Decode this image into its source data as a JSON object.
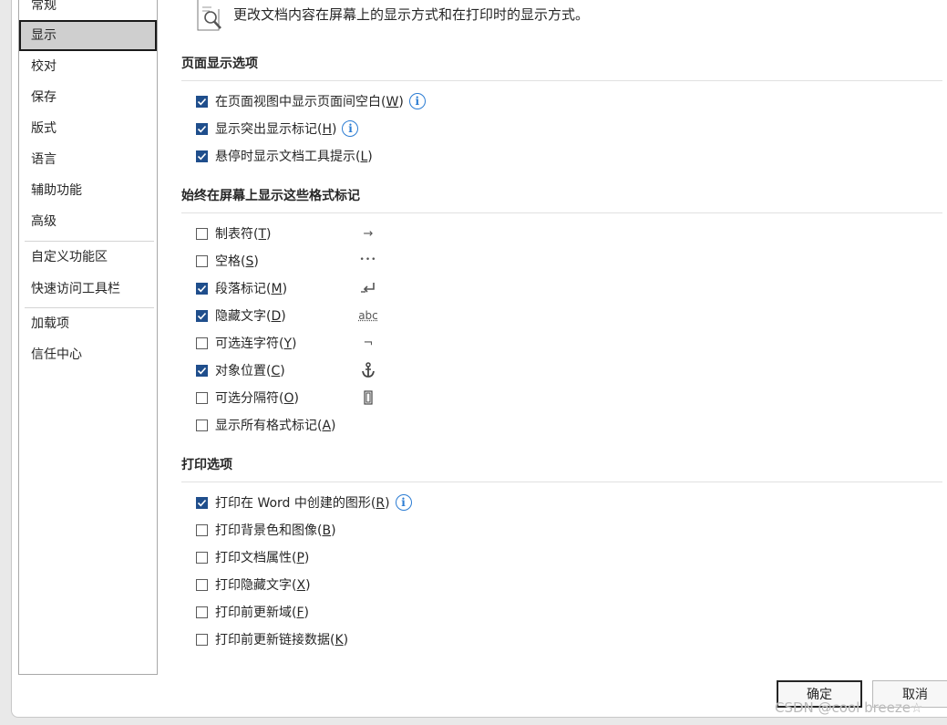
{
  "nav": {
    "items": [
      {
        "label": "常规"
      },
      {
        "label": "显示"
      },
      {
        "label": "校对"
      },
      {
        "label": "保存"
      },
      {
        "label": "版式"
      },
      {
        "label": "语言"
      },
      {
        "label": "辅助功能"
      },
      {
        "label": "高级"
      },
      {
        "label": "自定义功能区"
      },
      {
        "label": "快速访问工具栏"
      },
      {
        "label": "加载项"
      },
      {
        "label": "信任中心"
      }
    ],
    "selected": "显示"
  },
  "header": {
    "icon": "document-magnifier-icon",
    "text": "更改文档内容在屏幕上的显示方式和在打印时的显示方式。"
  },
  "sections": {
    "page_display": {
      "title": "页面显示选项",
      "options": [
        {
          "label": "在页面视图中显示页面间空白(",
          "key": "W",
          "checked": true,
          "info": true
        },
        {
          "label": "显示突出显示标记(",
          "key": "H",
          "checked": true,
          "info": true
        },
        {
          "label": "悬停时显示文档工具提示(",
          "key": "L",
          "checked": true,
          "info": false
        }
      ]
    },
    "format_marks": {
      "title": "始终在屏幕上显示这些格式标记",
      "options": [
        {
          "label": "制表符(",
          "key": "T",
          "checked": false,
          "mark": "→"
        },
        {
          "label": "空格(",
          "key": "S",
          "checked": false,
          "mark": "•••"
        },
        {
          "label": "段落标记(",
          "key": "M",
          "checked": true,
          "mark": "paragraph-mark-icon"
        },
        {
          "label": "隐藏文字(",
          "key": "D",
          "checked": true,
          "mark": "abc"
        },
        {
          "label": "可选连字符(",
          "key": "Y",
          "checked": false,
          "mark": "¬"
        },
        {
          "label": "对象位置(",
          "key": "C",
          "checked": true,
          "mark": "anchor-icon"
        },
        {
          "label": "可选分隔符(",
          "key": "O",
          "checked": false,
          "mark": "optional-break-icon"
        },
        {
          "label": "显示所有格式标记(",
          "key": "A",
          "checked": false,
          "mark": ""
        }
      ]
    },
    "print": {
      "title": "打印选项",
      "options": [
        {
          "label": "打印在 Word 中创建的图形(",
          "key": "R",
          "checked": true,
          "info": true
        },
        {
          "label": "打印背景色和图像(",
          "key": "B",
          "checked": false,
          "info": false
        },
        {
          "label": "打印文档属性(",
          "key": "P",
          "checked": false,
          "info": false
        },
        {
          "label": "打印隐藏文字(",
          "key": "X",
          "checked": false,
          "info": false
        },
        {
          "label": "打印前更新域(",
          "key": "F",
          "checked": false,
          "info": false
        },
        {
          "label": "打印前更新链接数据(",
          "key": "K",
          "checked": false,
          "info": false
        }
      ]
    }
  },
  "buttons": {
    "ok": "确定",
    "cancel": "取消"
  },
  "watermark": "CSDN @cool breeze☆",
  "colors": {
    "accent": "#1f4e8c",
    "info": "#2b7cd3",
    "selected_bg": "#cfcfcf"
  }
}
